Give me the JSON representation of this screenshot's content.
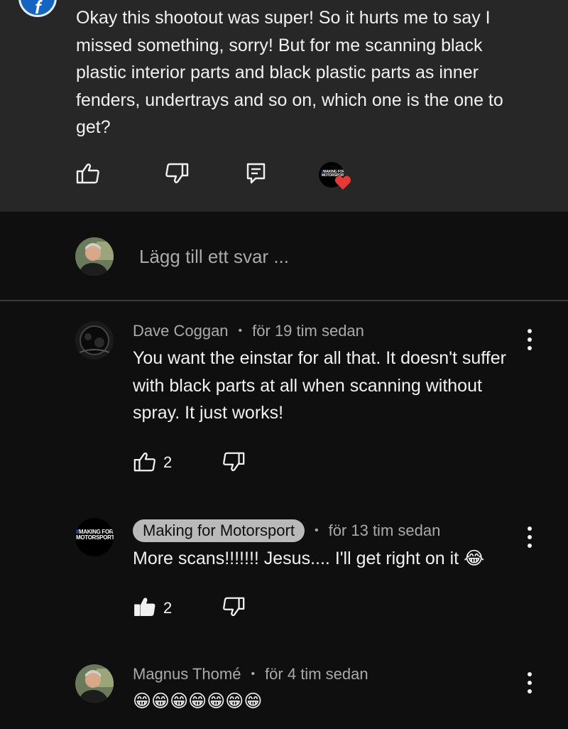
{
  "parent_comment": {
    "text": "Okay this shootout was super! So it hurts me to say I missed something, sorry! But for me scanning black plastic interior parts and black plastic parts as inner fenders, undertrays and so on, which one is the one to get?",
    "avatar_letter": "f",
    "hearted_by_logo": "MAKING FOR MOTORSPORT"
  },
  "add_reply": {
    "placeholder": "Lägg till ett svar ..."
  },
  "replies": [
    {
      "author": "Dave Coggan",
      "time": "för 19 tim sedan",
      "text": "You want the einstar for all that. It doesn't suffer with black parts at all when scanning without spray. It just works!",
      "likes": "2"
    },
    {
      "author": "Making for Motorsport",
      "time": "för 13 tim sedan",
      "text": "More scans!!!!!!! Jesus.... I'll get right on it 😂",
      "likes": "2",
      "avatar_logo": "MAKING FOR MOTORSPORT"
    },
    {
      "author": "Magnus Thomé",
      "time": "för 4 tim sedan",
      "text": "😁😁😁😁😁😁😁"
    }
  ],
  "separator_dot": "•",
  "colors": {
    "parent_bg": "#272727",
    "page_bg": "#0f0f0f",
    "heart": "#e53935",
    "creator_badge": "#b9b9b9"
  }
}
